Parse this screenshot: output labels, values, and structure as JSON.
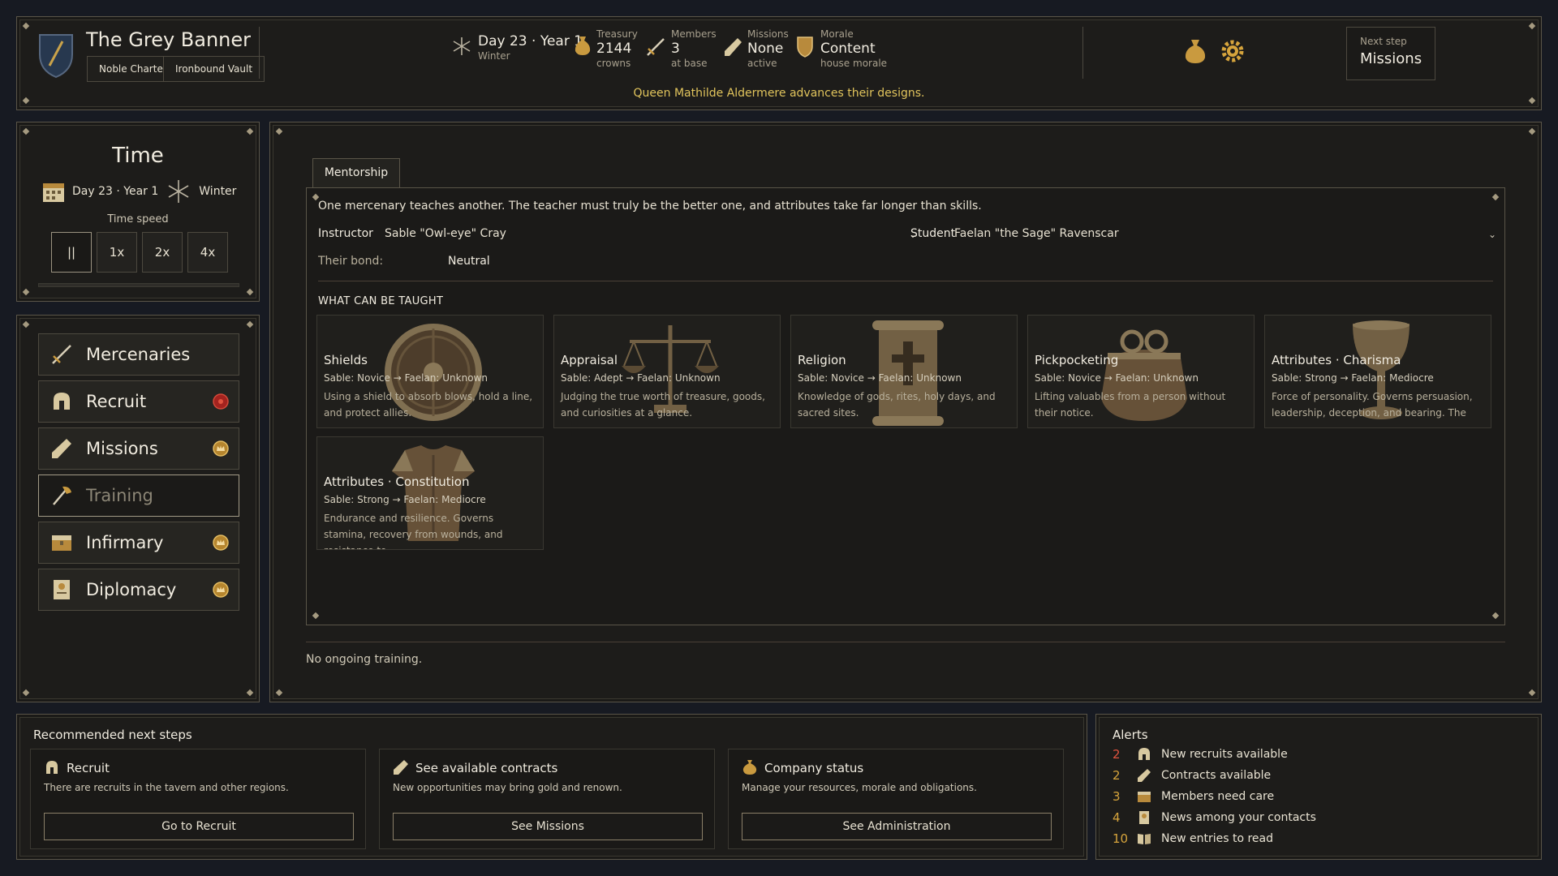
{
  "header": {
    "company_name": "The Grey Banner",
    "badges": [
      "Noble Charter",
      "Ironbound Vault"
    ],
    "date": {
      "value": "Day 23 · Year 1",
      "season": "Winter"
    },
    "treasury": {
      "label": "Treasury",
      "value": "2144",
      "sub": "crowns"
    },
    "members": {
      "label": "Members",
      "value": "3",
      "sub": "at base"
    },
    "missions": {
      "label": "Missions",
      "value": "None",
      "sub": "active"
    },
    "morale": {
      "label": "Morale",
      "value": "Content",
      "sub": "house morale"
    },
    "announcement": "Queen Mathilde Aldermere advances their designs.",
    "next_step": {
      "label": "Next step",
      "value": "Missions"
    },
    "icons": [
      "shield-emblem-icon",
      "snowflake-icon",
      "coin-bag-icon",
      "sword-icon",
      "scroll-icon",
      "morale-shield-icon",
      "gold-sack-icon",
      "gear-icon"
    ]
  },
  "time_panel": {
    "title": "Time",
    "date": "Day 23 · Year 1",
    "season": "Winter",
    "speed_label": "Time speed",
    "speeds": [
      "||",
      "1x",
      "2x",
      "4x"
    ],
    "active_speed": "||"
  },
  "nav": {
    "items": [
      {
        "label": "Mercenaries",
        "icon": "sword-icon",
        "badge": null
      },
      {
        "label": "Recruit",
        "icon": "helmet-icon",
        "badge": "red"
      },
      {
        "label": "Missions",
        "icon": "scroll-icon",
        "badge": "gold"
      },
      {
        "label": "Training",
        "icon": "axe-icon",
        "badge": null,
        "active": true
      },
      {
        "label": "Infirmary",
        "icon": "chest-icon",
        "badge": "gold"
      },
      {
        "label": "Diplomacy",
        "icon": "letter-icon",
        "badge": "gold"
      }
    ]
  },
  "main": {
    "tab": "Mentorship",
    "description": "One mercenary teaches another. The teacher must truly be the better one, and attributes take far longer than skills.",
    "instructor_label": "Instructor",
    "instructor_value": "Sable \"Owl-eye\" Cray",
    "student_label": "Student",
    "student_value": "Faelan \"the Sage\" Ravenscar",
    "bond_label": "Their bond:",
    "bond_value": "Neutral",
    "section_title": "WHAT CAN BE TAUGHT",
    "cards": [
      {
        "title": "Shields",
        "level": "Sable: Novice  →  Faelan: Unknown",
        "desc": "Using a shield to absorb blows, hold a line, and protect allies.",
        "art": "round-shield-icon"
      },
      {
        "title": "Appraisal",
        "level": "Sable: Adept  →  Faelan: Unknown",
        "desc": "Judging the true worth of treasure, goods, and curiosities at a glance.",
        "art": "scales-icon"
      },
      {
        "title": "Religion",
        "level": "Sable: Novice  →  Faelan: Unknown",
        "desc": "Knowledge of gods, rites, holy days, and sacred sites.",
        "art": "holy-scroll-icon"
      },
      {
        "title": "Pickpocketing",
        "level": "Sable: Novice  →  Faelan: Unknown",
        "desc": "Lifting valuables from a person without their notice.",
        "art": "coin-purse-icon"
      },
      {
        "title": "Attributes · Charisma",
        "level": "Sable: Strong  →  Faelan: Mediocre",
        "desc": "Force of personality. Governs persuasion, leadership, deception, and bearing. The",
        "art": "goblet-icon"
      },
      {
        "title": "Attributes · Constitution",
        "level": "Sable: Strong  →  Faelan: Mediocre",
        "desc": "Endurance and resilience. Governs stamina, recovery from wounds, and resistance to",
        "art": "armor-icon"
      }
    ],
    "no_training": "No ongoing training."
  },
  "recommended": {
    "title": "Recommended next steps",
    "cards": [
      {
        "title": "Recruit",
        "desc": "There are recruits in the tavern and other regions.",
        "button": "Go to Recruit",
        "icon": "helmet-icon"
      },
      {
        "title": "See available contracts",
        "desc": "New opportunities may bring gold and renown.",
        "button": "See Missions",
        "icon": "scroll-icon"
      },
      {
        "title": "Company status",
        "desc": "Manage your resources, morale and obligations.",
        "button": "See Administration",
        "icon": "coin-bag-icon"
      }
    ]
  },
  "alerts": {
    "title": "Alerts",
    "items": [
      {
        "count": "2",
        "text": "New recruits available",
        "color": "#e0533f",
        "icon": "helmet-icon"
      },
      {
        "count": "2",
        "text": "Contracts available",
        "color": "#d6a43c",
        "icon": "scroll-icon"
      },
      {
        "count": "3",
        "text": "Members need care",
        "color": "#d6a43c",
        "icon": "chest-icon"
      },
      {
        "count": "4",
        "text": "News among your contacts",
        "color": "#d6a43c",
        "icon": "letter-icon"
      },
      {
        "count": "10",
        "text": "New entries to read",
        "color": "#d6a43c",
        "icon": "book-icon"
      }
    ]
  },
  "colors": {
    "accent_gold": "#d6a43c",
    "announcement": "#e1c45c",
    "alert_red": "#e0533f",
    "panel_bg": "#1d1c1a",
    "page_bg": "#171a22"
  }
}
